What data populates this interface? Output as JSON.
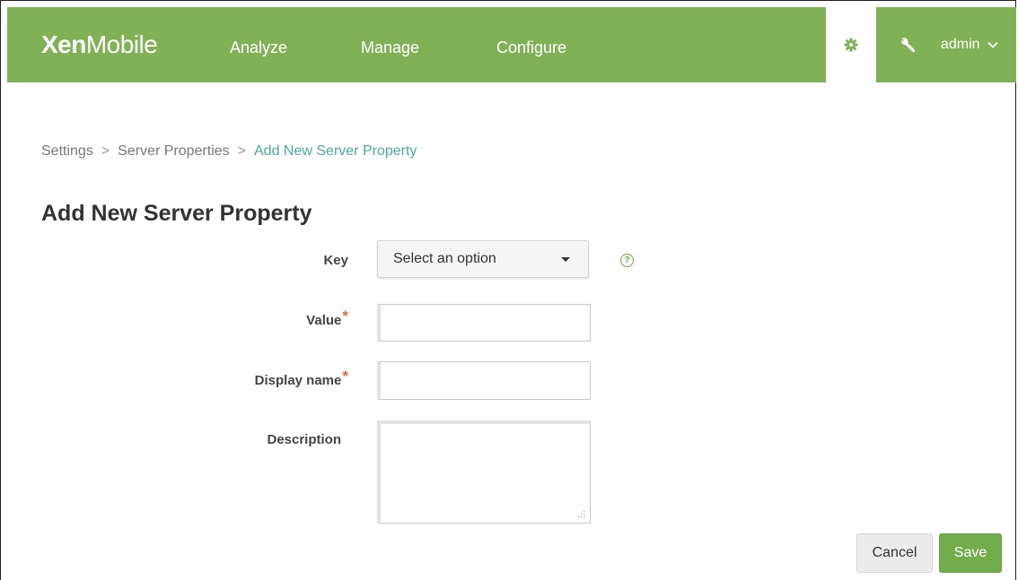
{
  "header": {
    "logo_bold": "Xen",
    "logo_light": "Mobile",
    "nav": {
      "analyze": "Analyze",
      "manage": "Manage",
      "configure": "Configure"
    },
    "user": "admin",
    "brand_color": "#80b156"
  },
  "breadcrumb": {
    "items": [
      "Settings",
      "Server Properties",
      "Add New Server Property"
    ],
    "separator": ">"
  },
  "page": {
    "title": "Add New Server Property"
  },
  "form": {
    "key": {
      "label": "Key",
      "selected": "Select an option"
    },
    "value": {
      "label": "Value",
      "required_mark": "*",
      "value": ""
    },
    "display_name": {
      "label": "Display name",
      "required_mark": "*",
      "value": ""
    },
    "description": {
      "label": "Description",
      "value": ""
    },
    "help_glyph": "?"
  },
  "actions": {
    "cancel": "Cancel",
    "save": "Save"
  }
}
